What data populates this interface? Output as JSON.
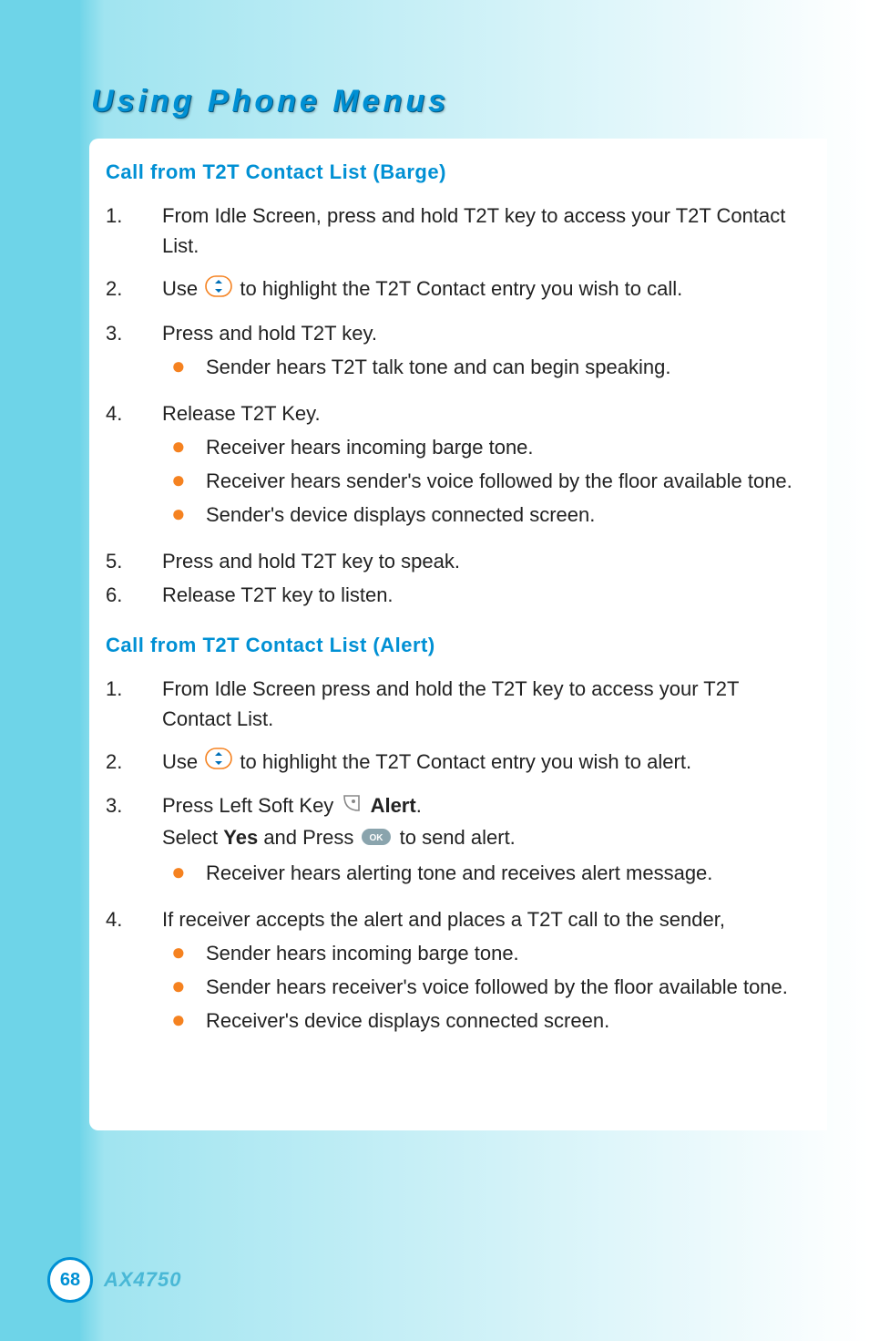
{
  "header": {
    "title": "Using Phone Menus"
  },
  "section1": {
    "heading": "Call from T2T Contact List (Barge)",
    "items": [
      {
        "n": "1.",
        "text": "From Idle Screen, press and hold T2T key to access your T2T Contact List."
      },
      {
        "n": "2.",
        "pre": "Use ",
        "post": " to highlight the T2T Contact entry you wish to call."
      },
      {
        "n": "3.",
        "text": "Press and hold T2T key.",
        "bullets": [
          "Sender hears T2T talk tone and can begin speaking."
        ]
      },
      {
        "n": "4.",
        "text": "Release T2T Key.",
        "bullets": [
          "Receiver hears incoming barge tone.",
          "Receiver hears sender's voice followed by the floor available tone.",
          "Sender's device displays connected screen."
        ]
      },
      {
        "n": "5.",
        "text": "Press and hold T2T key to speak."
      },
      {
        "n": "6.",
        "text": "Release T2T key to listen."
      }
    ]
  },
  "section2": {
    "heading": "Call from T2T Contact List (Alert)",
    "items": [
      {
        "n": "1.",
        "text": "From Idle Screen press and hold the T2T key to access your T2T Contact List."
      },
      {
        "n": "2.",
        "pre": "Use ",
        "post": " to highlight the T2T Contact entry you wish to alert."
      },
      {
        "n": "3.",
        "line1_pre": "Press Left Soft Key ",
        "line1_bold": "Alert",
        "line1_post": ".",
        "line2_pre": "Select ",
        "line2_bold1": "Yes",
        "line2_mid": " and Press ",
        "line2_post": " to send alert.",
        "bullets": [
          "Receiver hears alerting tone and receives alert message."
        ]
      },
      {
        "n": "4.",
        "text": "If receiver accepts the alert and places a T2T call to the sender,",
        "bullets": [
          "Sender hears incoming barge tone.",
          "Sender hears receiver's voice followed by the floor available tone.",
          "Receiver's device displays connected screen."
        ]
      }
    ]
  },
  "footer": {
    "page": "68",
    "model": "AX4750"
  }
}
